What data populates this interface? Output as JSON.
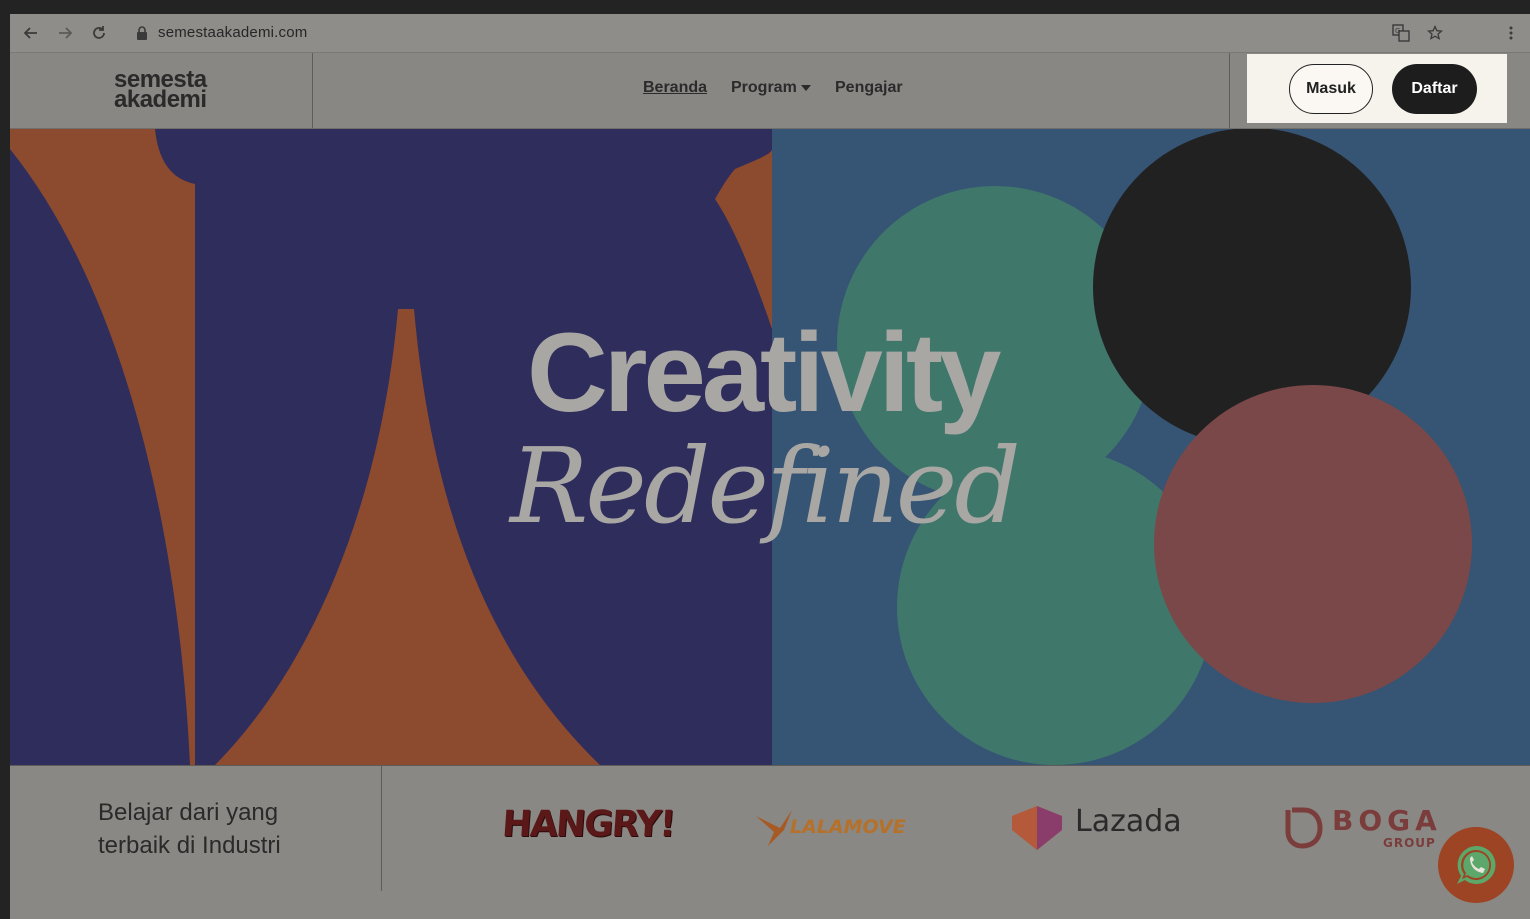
{
  "browser": {
    "url": "semestaakademi.com"
  },
  "site": {
    "logo_line1": "semesta",
    "logo_line2": "akademi",
    "nav": {
      "beranda": "Beranda",
      "program": "Program",
      "pengajar": "Pengajar"
    },
    "auth": {
      "login": "Masuk",
      "register": "Daftar"
    }
  },
  "hero": {
    "title": "Creativity",
    "subtitle": "Redefined"
  },
  "partners": {
    "tagline_line1": "Belajar dari yang",
    "tagline_line2": "terbaik di Industri",
    "logos": {
      "hangry": "HANGRY!",
      "lalamove": "LALAMOVE",
      "lazada": "Lazada",
      "boga": "BOGA",
      "boga_sub": "GROUP"
    }
  },
  "colors": {
    "hero_navy": "#2f2d5c",
    "hero_orange": "#8c4a2e",
    "hero_blue": "#365473",
    "hero_teal": "#3f776b",
    "hero_black": "#212121",
    "hero_rose": "#7b4849",
    "daftar_bg": "#1d1d1d"
  },
  "icons": {
    "back": "arrow-left-icon",
    "forward": "arrow-right-icon",
    "reload": "reload-icon",
    "lock": "lock-icon",
    "translate": "translate-icon",
    "bookmark": "star-icon",
    "menu": "kebab-menu-icon",
    "whatsapp": "whatsapp-icon"
  }
}
